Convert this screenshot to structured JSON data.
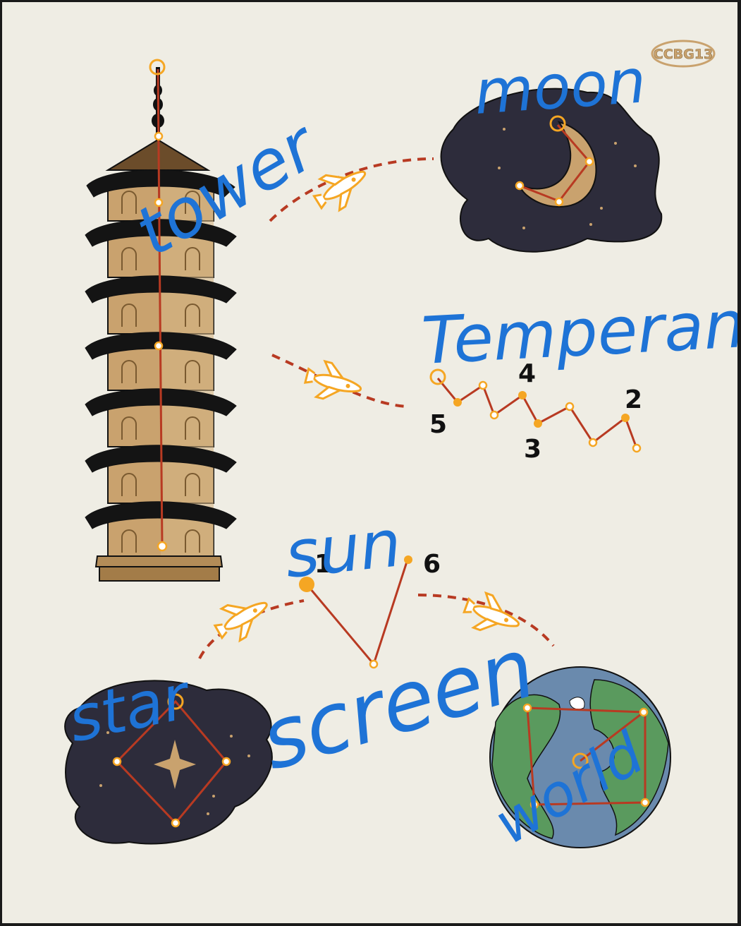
{
  "logo_text": "CCBG13",
  "words": {
    "tower": "tower",
    "moon": "moon",
    "temperance": "Temperance",
    "sun": "sun",
    "star": "star",
    "screen": "screen",
    "world": "world"
  },
  "sequence_numbers": [
    "1",
    "2",
    "3",
    "4",
    "5",
    "6"
  ],
  "colors": {
    "background": "#efede4",
    "handwriting": "#1e73d6",
    "constellation_line": "#b83a22",
    "node": "#f5a623",
    "night_sky": "#2d2c3b",
    "pagoda_body": "#c9a26e",
    "pagoda_roof": "#141414"
  },
  "icons": {
    "rocket": "space-shuttle-icon",
    "star": "four-point-star-icon",
    "moon": "crescent-moon-icon",
    "globe": "earth-globe-icon",
    "tower": "pagoda-tower-icon"
  }
}
